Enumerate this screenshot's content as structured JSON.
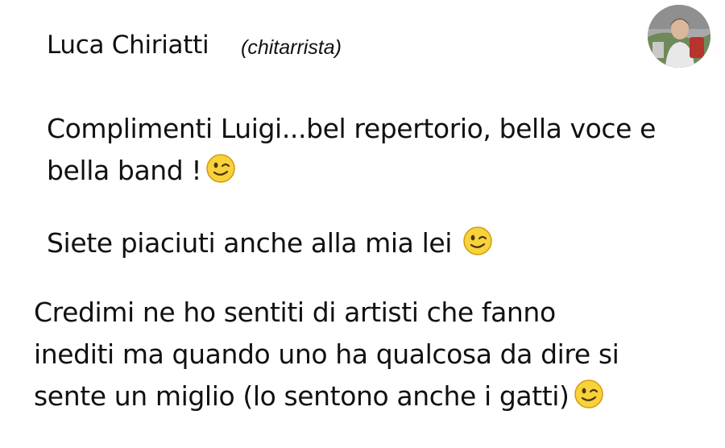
{
  "comment": {
    "author": "Luca Chiriatti",
    "role": "(chitarrista)",
    "paragraph_1": {
      "line_1": "Complimenti Luigi...bel repertorio, bella voce e",
      "line_2": "bella band !"
    },
    "paragraph_2": {
      "line_1": "Siete piaciuti anche alla mia lei"
    },
    "paragraph_3": {
      "line_1": "Credimi ne ho sentiti di artisti che fanno",
      "line_2": "inediti ma quando uno ha qualcosa da dire si",
      "line_3": "sente un miglio (lo sentono anche i gatti)"
    },
    "emoji": "wink-emoji-icon"
  },
  "colors": {
    "text": "#111111",
    "emoji_face": "#f7d23a",
    "emoji_outline": "#d39a10"
  }
}
